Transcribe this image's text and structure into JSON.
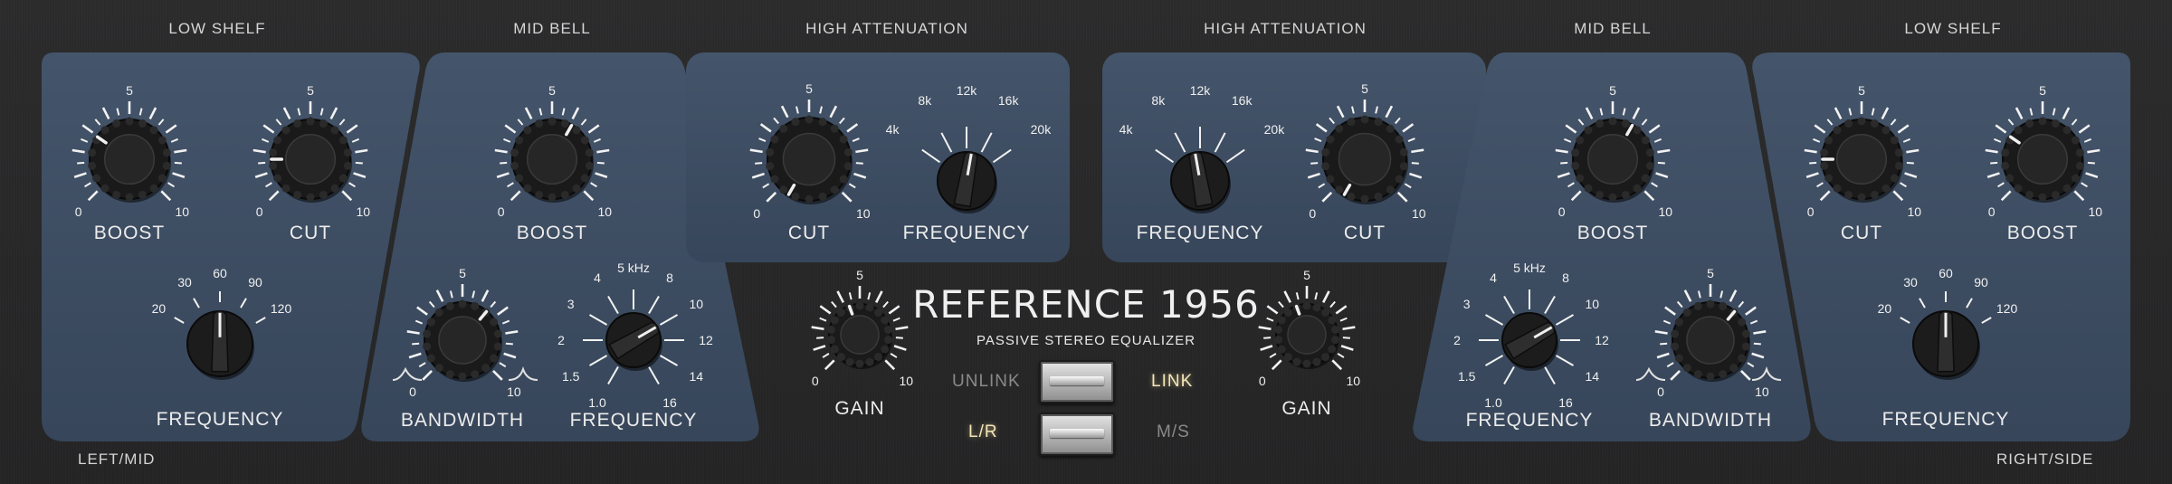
{
  "product": {
    "name": "REFERENCE 1956",
    "subtitle": "PASSIVE STEREO EQUALIZER"
  },
  "sections": {
    "low_shelf_left": "LOW SHELF",
    "mid_bell_left": "MID BELL",
    "high_att_left": "HIGH ATTENUATION",
    "high_att_right": "HIGH ATTENUATION",
    "mid_bell_right": "MID BELL",
    "low_shelf_right": "LOW SHELF"
  },
  "footer": {
    "left": "LEFT/MID",
    "right": "RIGHT/SIDE"
  },
  "labels": {
    "boost": "BOOST",
    "cut": "CUT",
    "frequency": "FREQUENCY",
    "bandwidth": "BANDWIDTH",
    "gain": "GAIN"
  },
  "scale": {
    "min": "0",
    "mid": "5",
    "max": "10"
  },
  "low_freq_ticks": [
    "20",
    "30",
    "60",
    "90",
    "120"
  ],
  "mid_freq_ticks": [
    "1.0",
    "1.5",
    "2",
    "3",
    "4",
    "5 kHz",
    "8",
    "10",
    "12",
    "14",
    "16"
  ],
  "high_freq_ticks": [
    "4k",
    "8k",
    "12k",
    "16k",
    "20k"
  ],
  "link_switch": {
    "off_label": "UNLINK",
    "on_label": "LINK",
    "state": "LINK"
  },
  "mode_switch": {
    "left_label": "L/R",
    "right_label": "M/S",
    "state": "L/R"
  },
  "colors": {
    "panel": "#3d4c5f",
    "background": "#262627",
    "text": "#ececec",
    "active": "#f3e6b8"
  }
}
